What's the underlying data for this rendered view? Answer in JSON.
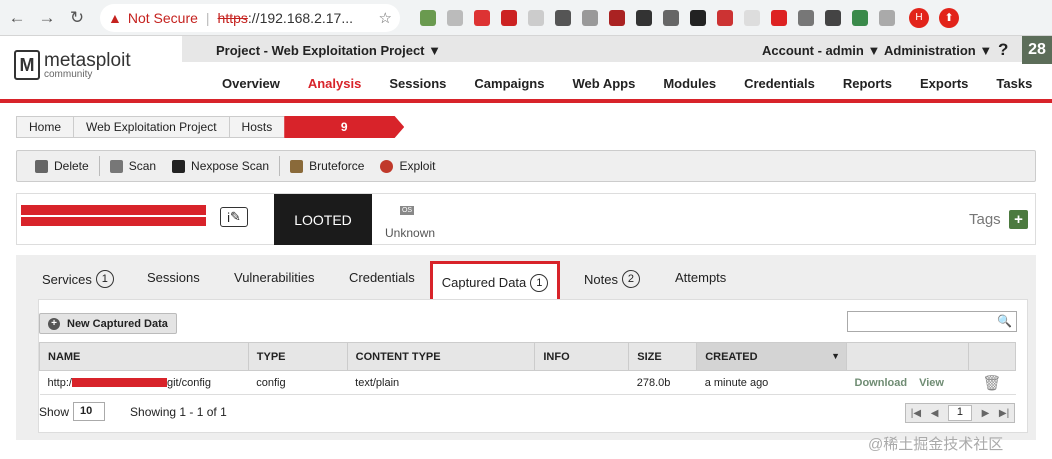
{
  "browser": {
    "security_label": "Not Secure",
    "url_scheme": "https",
    "url_rest": "://192.168.2.17...",
    "user_initial": "H"
  },
  "header": {
    "logo_text": "metasploit",
    "logo_sub": "community",
    "project": "Project - Web Exploitation Project ▼",
    "account": "Account - admin ▼",
    "administration": "Administration ▼",
    "help": "?",
    "badge": "28"
  },
  "nav": [
    "Overview",
    "Analysis",
    "Sessions",
    "Campaigns",
    "Web Apps",
    "Modules",
    "Credentials",
    "Reports",
    "Exports",
    "Tasks"
  ],
  "breadcrumb": {
    "items": [
      "Home",
      "Web Exploitation Project",
      "Hosts"
    ],
    "last": "9"
  },
  "toolbar": {
    "delete": "Delete",
    "scan": "Scan",
    "nexpose": "Nexpose Scan",
    "bruteforce": "Bruteforce",
    "exploit": "Exploit"
  },
  "host": {
    "status": "LOOTED",
    "os_icon": "OS",
    "os": "Unknown",
    "tags_label": "Tags",
    "tags_add": "+",
    "info_label": "i"
  },
  "tabs": {
    "services": {
      "label": "Services",
      "count": "1"
    },
    "sessions": {
      "label": "Sessions"
    },
    "vulnerabilities": {
      "label": "Vulnerabilities"
    },
    "credentials": {
      "label": "Credentials"
    },
    "captured": {
      "label": "Captured Data",
      "count": "1"
    },
    "notes": {
      "label": "Notes",
      "count": "2"
    },
    "attempts": {
      "label": "Attempts"
    }
  },
  "captured": {
    "new_button": "New Captured Data",
    "columns": [
      "NAME",
      "TYPE",
      "CONTENT TYPE",
      "INFO",
      "SIZE",
      "CREATED"
    ],
    "rows": [
      {
        "name_prefix": "http:/",
        "name_suffix": "git/config",
        "type": "config",
        "content_type": "text/plain",
        "info": "",
        "size": "278.0b",
        "created": "a minute ago",
        "download": "Download",
        "view": "View"
      }
    ],
    "show_label": "Show",
    "show_value": "10",
    "showing": "Showing 1 - 1 of 1",
    "page": "1"
  },
  "colors": {
    "accent": "#d8232a",
    "dark": "#1b1b1b",
    "green": "#4c7a3f"
  },
  "watermark": "@稀土掘金技术社区"
}
